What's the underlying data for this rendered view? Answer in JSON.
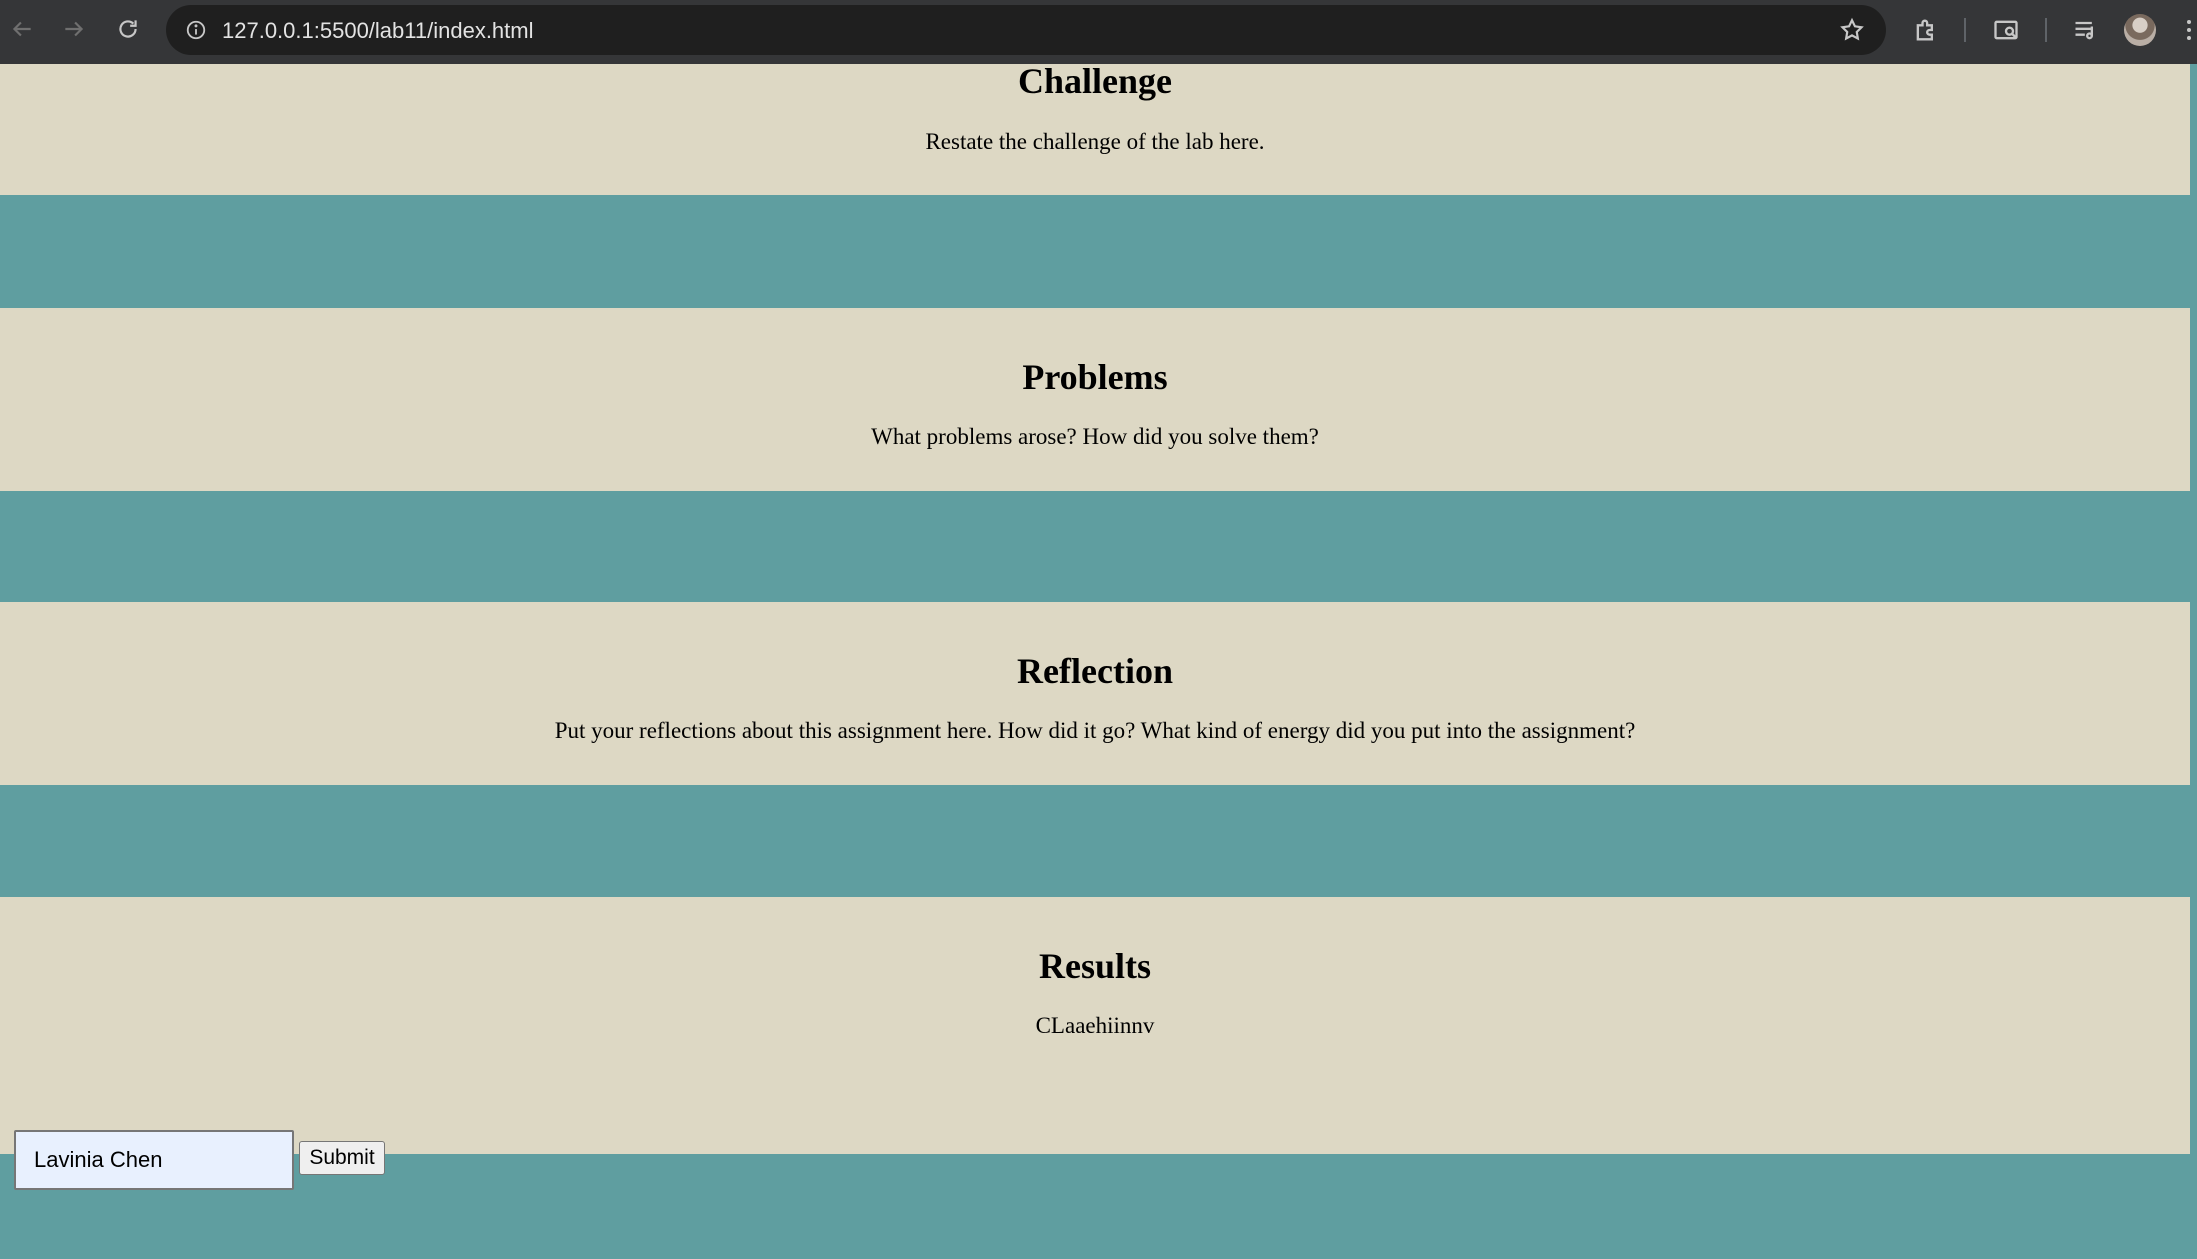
{
  "browser": {
    "url": "127.0.0.1:5500/lab11/index.html"
  },
  "sections": {
    "challenge": {
      "heading": "Challenge",
      "text": "Restate the challenge of the lab here."
    },
    "problems": {
      "heading": "Problems",
      "text": "What problems arose? How did you solve them?"
    },
    "reflection": {
      "heading": "Reflection",
      "text": "Put your reflections about this assignment here. How did it go? What kind of energy did you put into the assignment?"
    },
    "results": {
      "heading": "Results",
      "output": "CLaaehiinnv",
      "input_value": "Lavinia Chen",
      "submit_label": "Submit"
    }
  },
  "colors": {
    "page_background": "#5f9ea0",
    "section_background": "#ddd8c4",
    "chrome_background": "#353638"
  },
  "icons": [
    "back-arrow-icon",
    "forward-arrow-icon",
    "reload-icon",
    "site-info-icon",
    "bookmark-star-icon",
    "extensions-icon",
    "search-tab-icon",
    "media-controls-icon",
    "profile-avatar",
    "more-menu-icon"
  ]
}
